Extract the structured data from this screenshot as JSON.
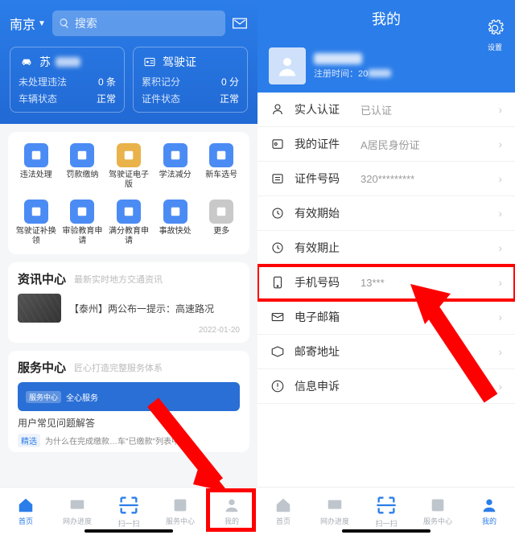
{
  "left": {
    "city": "南京",
    "search_placeholder": "搜索",
    "vehicle": {
      "title": "苏",
      "row1_label": "未处理违法",
      "row1_value": "0 条",
      "row2_label": "车辆状态",
      "row2_value": "正常"
    },
    "license": {
      "title": "驾驶证",
      "row1_label": "累积记分",
      "row1_value": "0 分",
      "row2_label": "证件状态",
      "row2_value": "正常"
    },
    "grid": [
      "违法处理",
      "罚款缴纳",
      "驾驶证电子版",
      "学法减分",
      "新车选号",
      "驾驶证补换领",
      "审验教育申请",
      "满分教育申请",
      "事故快处",
      "更多"
    ],
    "grid_colors": [
      "#4b8bf4",
      "#4b8bf4",
      "#e9b24a",
      "#4b8bf4",
      "#4b8bf4",
      "#4b8bf4",
      "#4b8bf4",
      "#4b8bf4",
      "#4b8bf4",
      "#c9c9c9"
    ],
    "info_center_title": "资讯中心",
    "info_center_sub": "最新实时地方交通资讯",
    "news_title": "【泰州】两公布一提示：高速路况",
    "news_date": "2022-01-20",
    "service_title": "服务中心",
    "service_sub": "匠心打造完整服务体系",
    "service_tag": "服务中心",
    "service_pill": "全心服务",
    "faq": "用户常见问题解答",
    "faq_item": "为什么在完成缴款…车\"已缴款\"列表中…",
    "faq_tag": "精选"
  },
  "right": {
    "title": "我的",
    "settings": "设置",
    "reg_prefix": "注册时间：20",
    "list": [
      {
        "label": "实人认证",
        "value": "已认证"
      },
      {
        "label": "我的证件",
        "value": "A居民身份证"
      },
      {
        "label": "证件号码",
        "value": "320*********"
      },
      {
        "label": "有效期始",
        "value": ""
      },
      {
        "label": "有效期止",
        "value": ""
      },
      {
        "label": "手机号码",
        "value": "13***"
      },
      {
        "label": "电子邮箱",
        "value": ""
      },
      {
        "label": "邮寄地址",
        "value": ""
      },
      {
        "label": "信息申诉",
        "value": ""
      }
    ]
  },
  "tabs": [
    "首页",
    "网办进度",
    "扫一扫",
    "服务中心",
    "我的"
  ]
}
